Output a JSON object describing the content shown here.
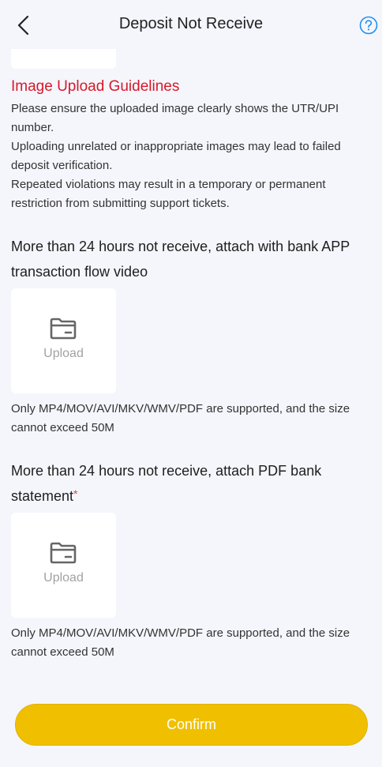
{
  "header": {
    "title": "Deposit Not Receive",
    "back_icon": "chevron-left-icon",
    "help_icon": "question-circle-icon"
  },
  "guidelines": {
    "title": "Image Upload Guidelines",
    "lines": [
      "Please ensure the uploaded image clearly shows the UTR/UPI number.",
      "Uploading unrelated or inappropriate images may lead to failed deposit verification.",
      "Repeated violations may result in a temporary or permanent restriction from submitting support tickets."
    ]
  },
  "sections": [
    {
      "title": "More than 24 hours not receive, attach with bank APP transaction flow video",
      "required": false,
      "upload_label": "Upload",
      "upload_icon": "folder-icon",
      "hint": "Only MP4/MOV/AVI/MKV/WMV/PDF are supported, and the size cannot exceed 50M"
    },
    {
      "title": "More than 24 hours not receive, attach PDF bank statement",
      "required": true,
      "required_mark": "*",
      "upload_label": "Upload",
      "upload_icon": "folder-icon",
      "hint": "Only MP4/MOV/AVI/MKV/WMV/PDF are supported, and the size cannot exceed 50M"
    }
  ],
  "confirm_label": "Confirm",
  "colors": {
    "background": "#f5f6fc",
    "accent": "#f0c000",
    "warning": "#d6192a",
    "help_icon": "#1e8ff0"
  }
}
